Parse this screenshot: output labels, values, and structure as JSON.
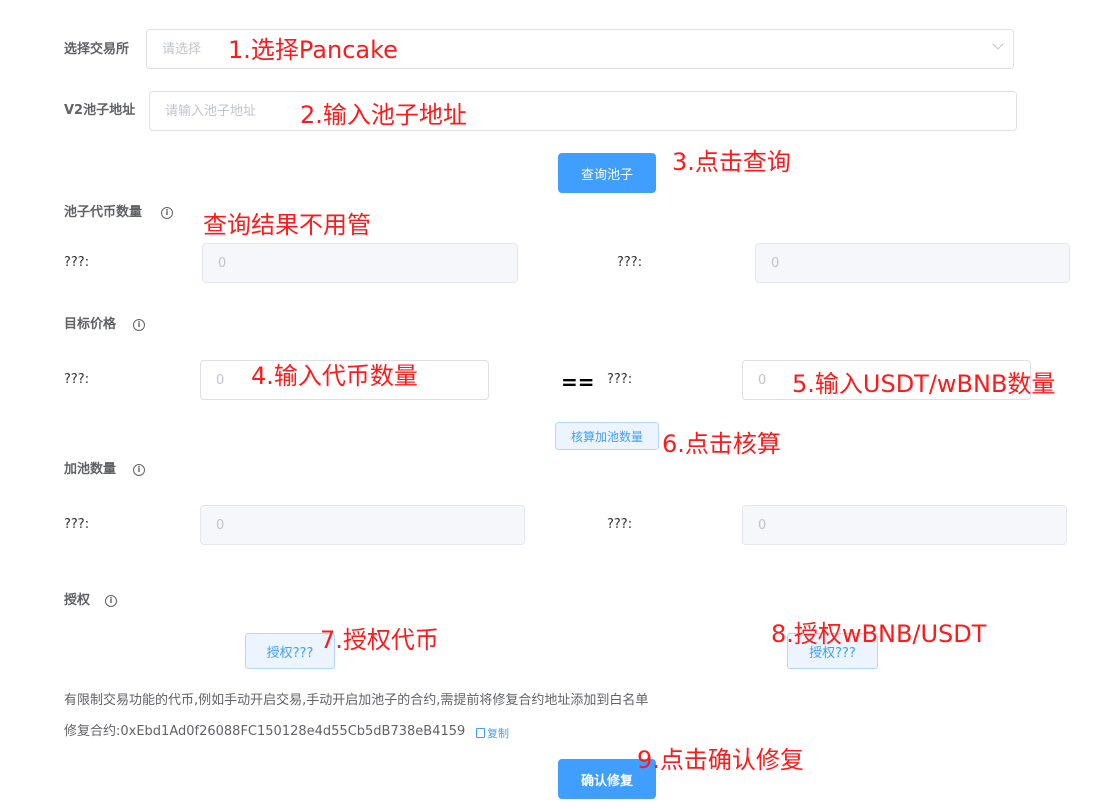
{
  "form": {
    "exchange_label": "选择交易所",
    "exchange_placeholder": "请选择",
    "pool_address_label": "V2池子地址",
    "pool_address_placeholder": "请输入池子地址",
    "query_button": "查询池子",
    "pool_amount_label": "池子代币数量",
    "pool_token_a_label": "???:",
    "pool_token_a_value": "0",
    "pool_token_b_label": "???:",
    "pool_token_b_value": "0",
    "target_price_label": "目标价格",
    "target_a_label": "???:",
    "target_a_placeholder": "0",
    "equals": "==",
    "target_b_label": "???:",
    "target_b_placeholder": "0",
    "calc_button": "核算加池数量",
    "add_amount_label": "加池数量",
    "add_a_label": "???:",
    "add_a_value": "0",
    "add_b_label": "???:",
    "add_b_value": "0",
    "authorize_label": "授权",
    "authorize_a_button": "授权???",
    "authorize_b_button": "授权???",
    "note_text": "有限制交易功能的代币,例如手动开启交易,手动开启加池子的合约,需提前将修复合约地址添加到白名单",
    "repair_contract_text": "修复合约:0xEbd1Ad0f26088FC150128e4d55Cb5dB738eB4159",
    "copy_label": "复制",
    "confirm_button": "确认修复"
  },
  "annotations": {
    "step1": "1.选择Pancake",
    "step2": "2.输入池子地址",
    "step3": "3.点击查询",
    "ignore": "查询结果不用管",
    "step4": "4.输入代币数量",
    "step5": "5.输入USDT/wBNB数量",
    "step6": "6.点击核算",
    "step7": "7.授权代币",
    "step8": "8.授权wBNB/USDT",
    "step9": "9.点击确认修复"
  },
  "colors": {
    "primary": "#409eff",
    "annotation": "#ff1a1a"
  },
  "icons": [
    "info-icon",
    "chevron-down-icon",
    "copy-icon"
  ]
}
